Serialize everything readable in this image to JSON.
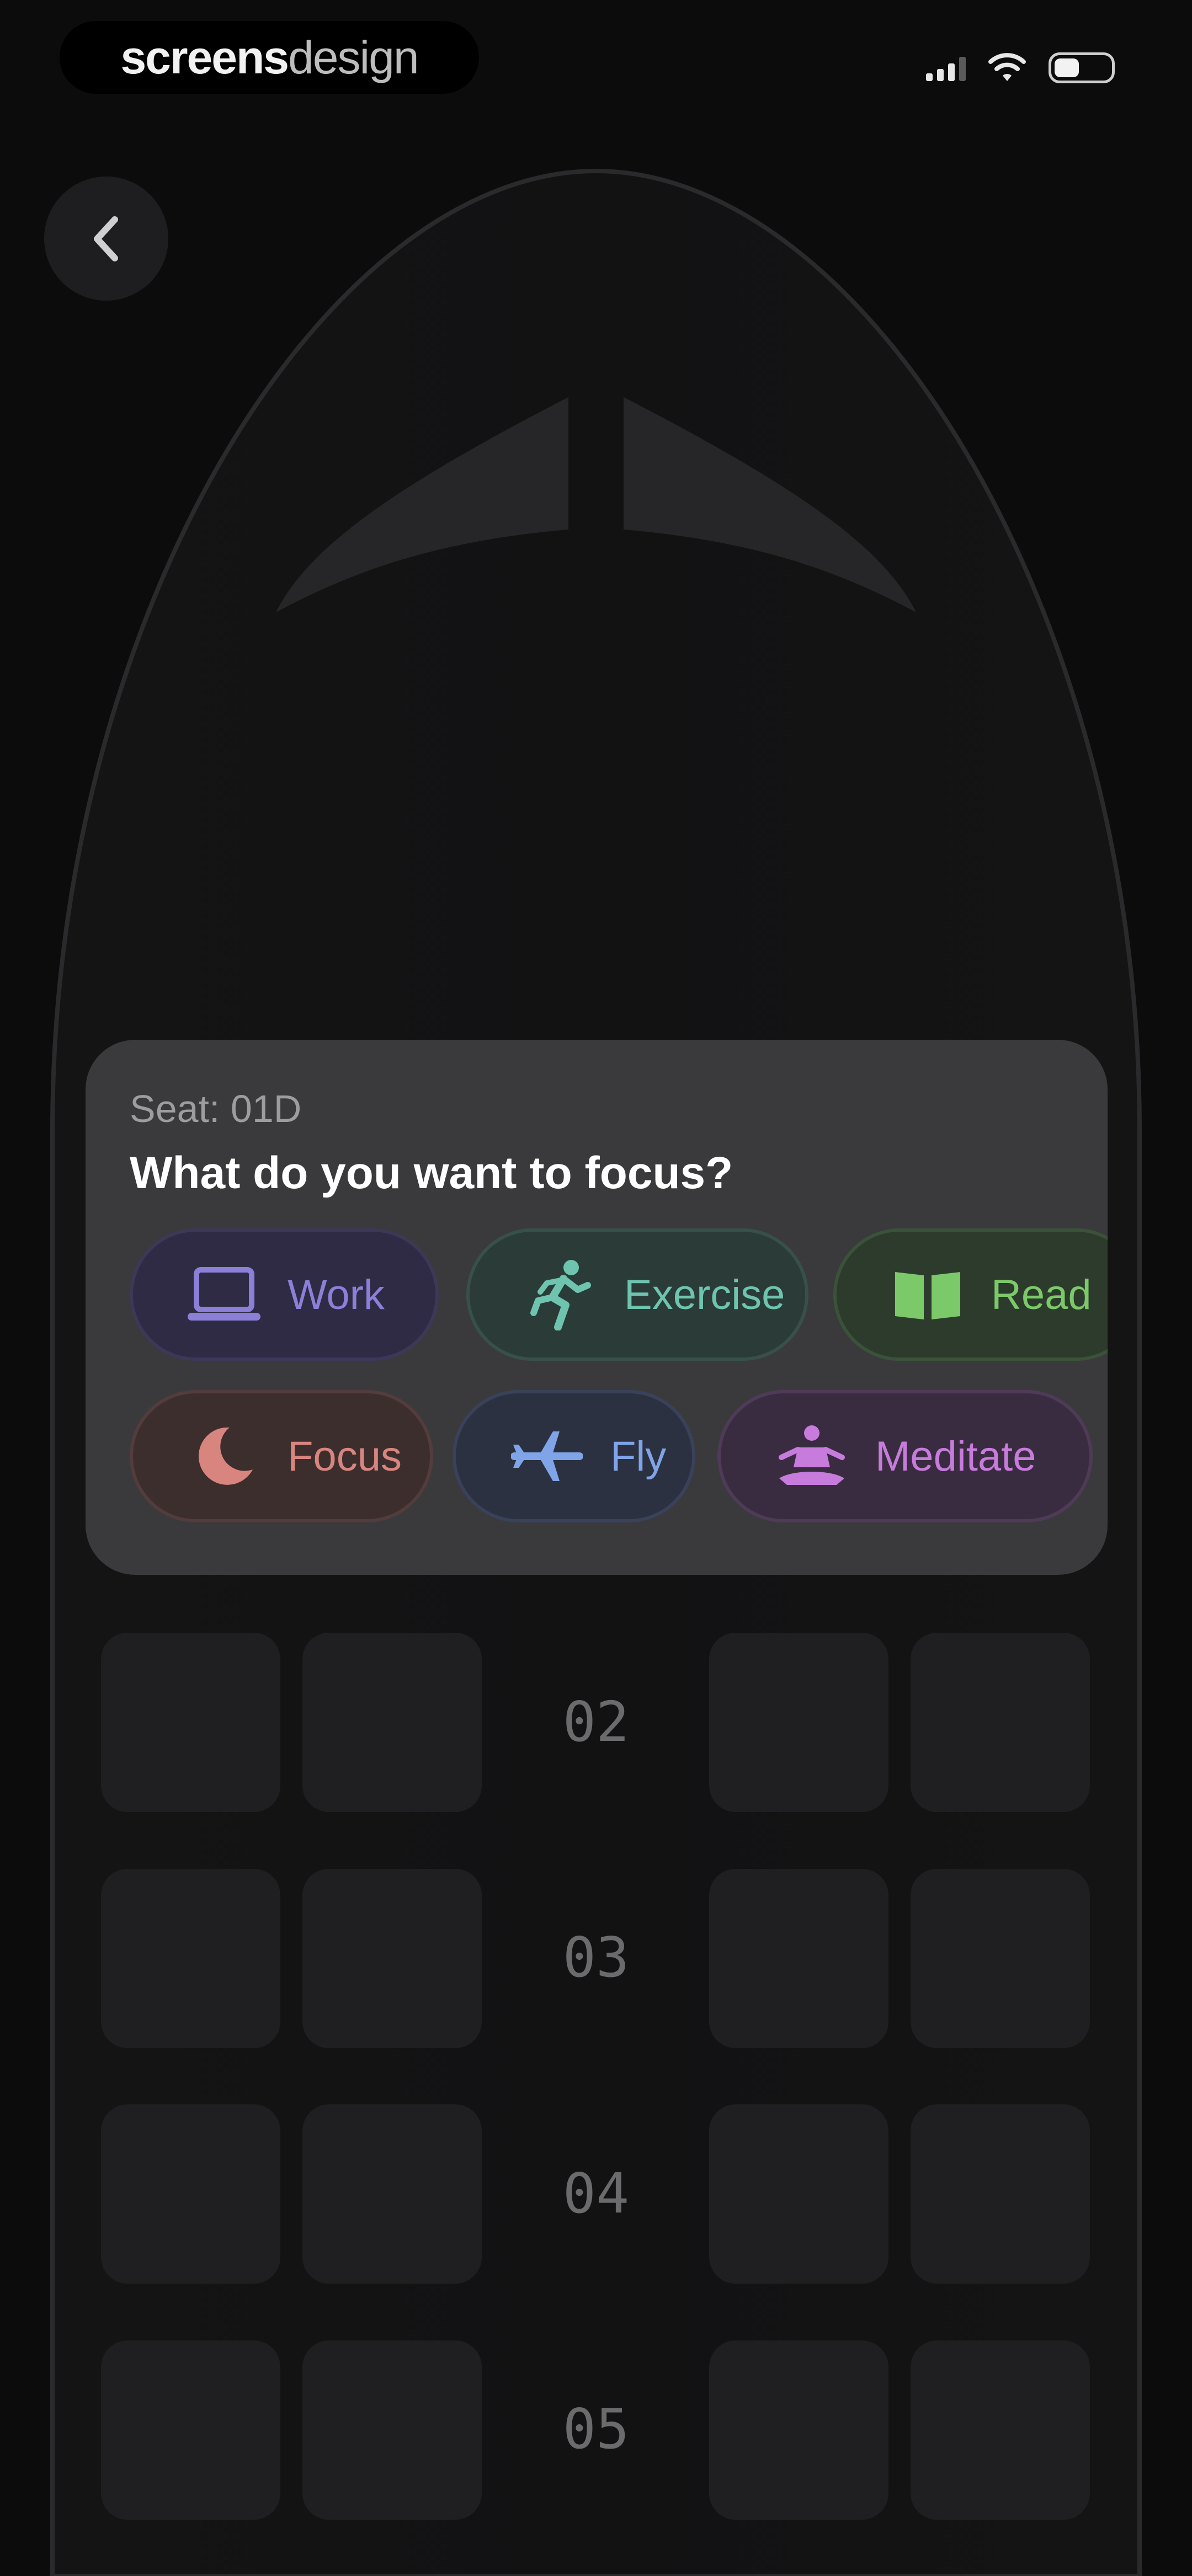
{
  "status_bar": {
    "brand_strong": "screens",
    "brand_light": "design",
    "icons": [
      "cellular-signal-icon",
      "wifi-icon",
      "battery-icon"
    ]
  },
  "navigation": {
    "back_icon": "chevron-left-icon"
  },
  "focus_panel": {
    "seat_label": "Seat: 01D",
    "question": "What do you want to focus?",
    "options": [
      {
        "label": "Work",
        "icon": "laptop-icon",
        "color": "#8b7fd8"
      },
      {
        "label": "Exercise",
        "icon": "running-person-icon",
        "color": "#6ec4ae"
      },
      {
        "label": "Read",
        "icon": "open-book-icon",
        "color": "#7cc96a"
      },
      {
        "label": "Focus",
        "icon": "crescent-moon-icon",
        "color": "#d9857f"
      },
      {
        "label": "Fly",
        "icon": "airplane-icon",
        "color": "#7fa5e8"
      },
      {
        "label": "Meditate",
        "icon": "meditation-icon",
        "color": "#c77bdc"
      }
    ]
  },
  "seat_map": {
    "rows": [
      {
        "label": "02"
      },
      {
        "label": "03"
      },
      {
        "label": "04"
      },
      {
        "label": "05"
      }
    ]
  },
  "colors": {
    "background": "#0c0c0d",
    "panel": "#3a3a3c",
    "seat": "#1f1f21"
  }
}
